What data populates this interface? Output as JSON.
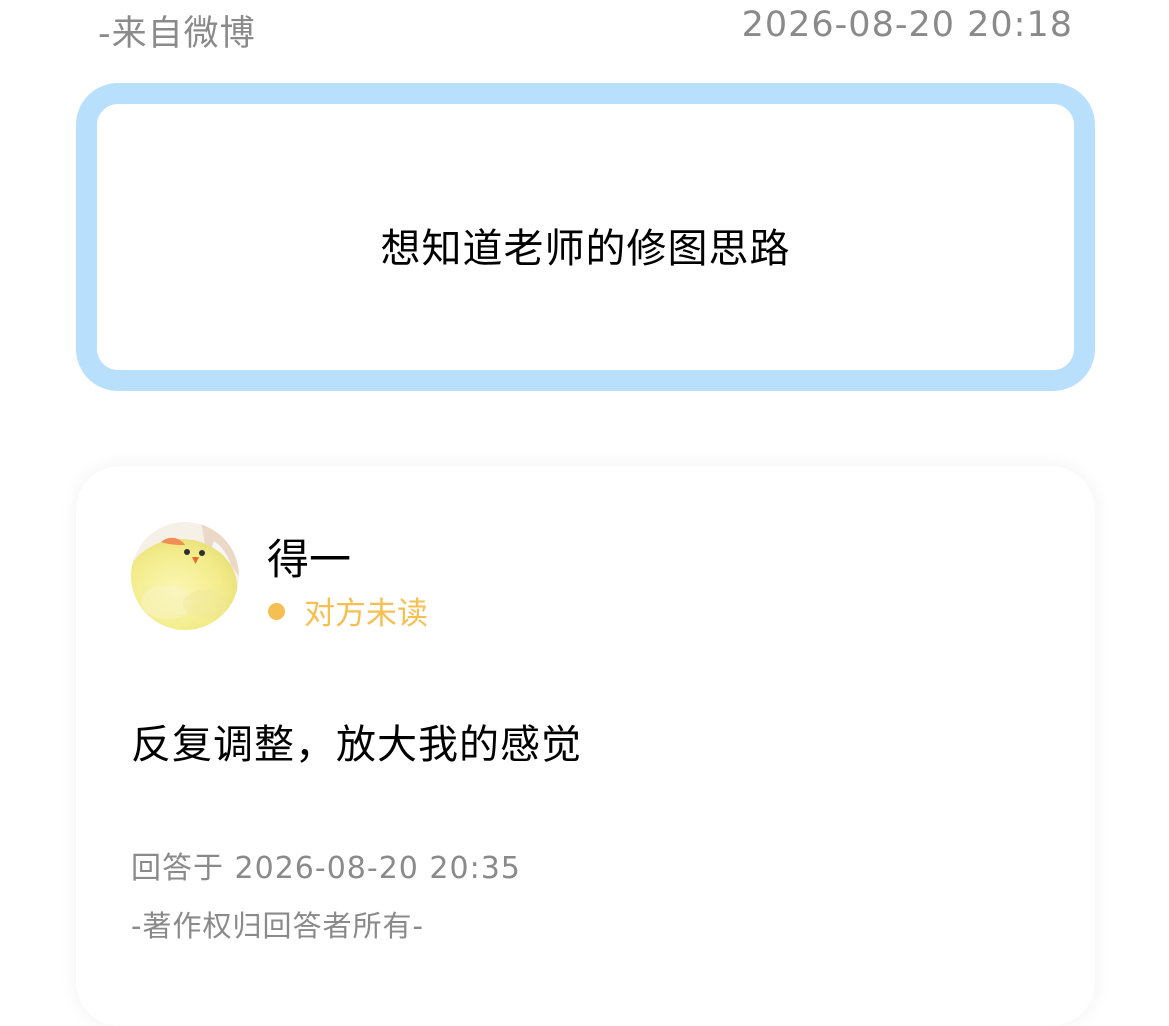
{
  "question": {
    "source": "-来自微博",
    "time": "2026-08-20 20:18",
    "text": "想知道老师的修图思路"
  },
  "answer": {
    "answerer_name": "得一",
    "avatar_icon": "yellow-chick-plush-avatar",
    "status_text": "对方未读",
    "text": "反复调整，放大我的感觉",
    "time": "回答于 2026-08-20 20:35",
    "copyright": "-著作权归回答者所有-"
  },
  "colors": {
    "question_border": "#b8dffc",
    "status": "#f6bf52",
    "muted_text": "#8a8a8a"
  }
}
